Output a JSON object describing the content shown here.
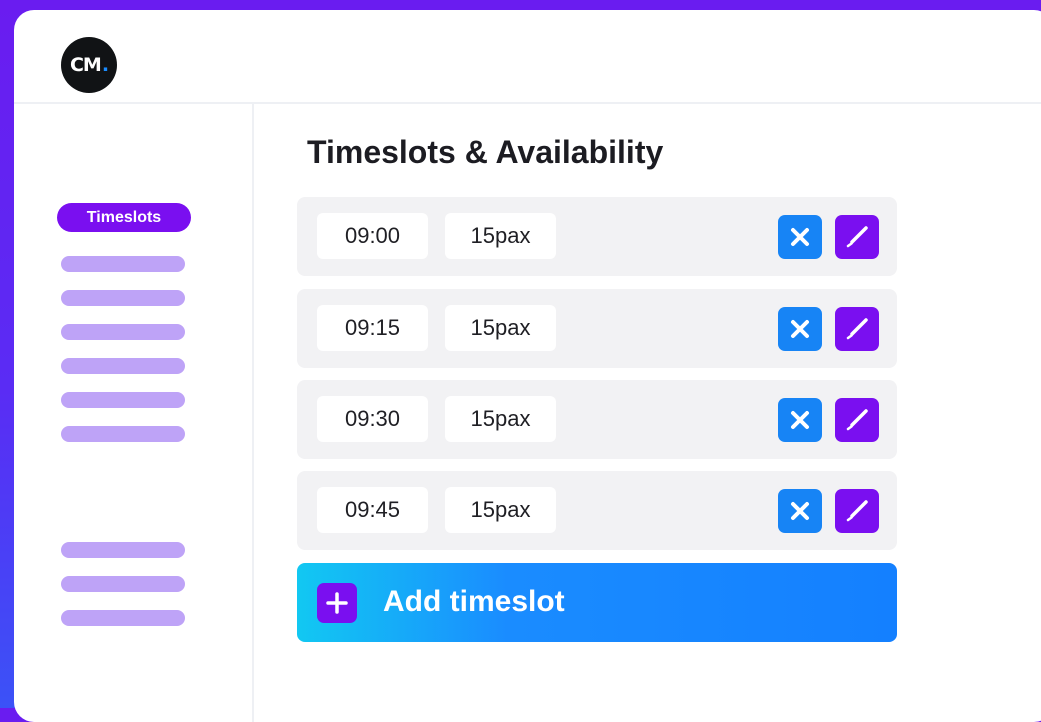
{
  "header": {
    "logo_text": "CM",
    "logo_dot": "."
  },
  "sidebar": {
    "active_item": "Timeslots",
    "placeholder_count": 9
  },
  "main": {
    "title": "Timeslots & Availability",
    "timeslots": [
      {
        "time": "09:00",
        "capacity": "15pax"
      },
      {
        "time": "09:15",
        "capacity": "15pax"
      },
      {
        "time": "09:30",
        "capacity": "15pax"
      },
      {
        "time": "09:45",
        "capacity": "15pax"
      }
    ],
    "add_button_label": "Add timeslot"
  },
  "colors": {
    "brand_purple": "#7a0ff0",
    "action_blue": "#1784f5",
    "sidebar_placeholder": "#bea3f7"
  },
  "icons": {
    "delete": "close-icon",
    "edit": "pencil-icon",
    "add": "plus-icon"
  }
}
